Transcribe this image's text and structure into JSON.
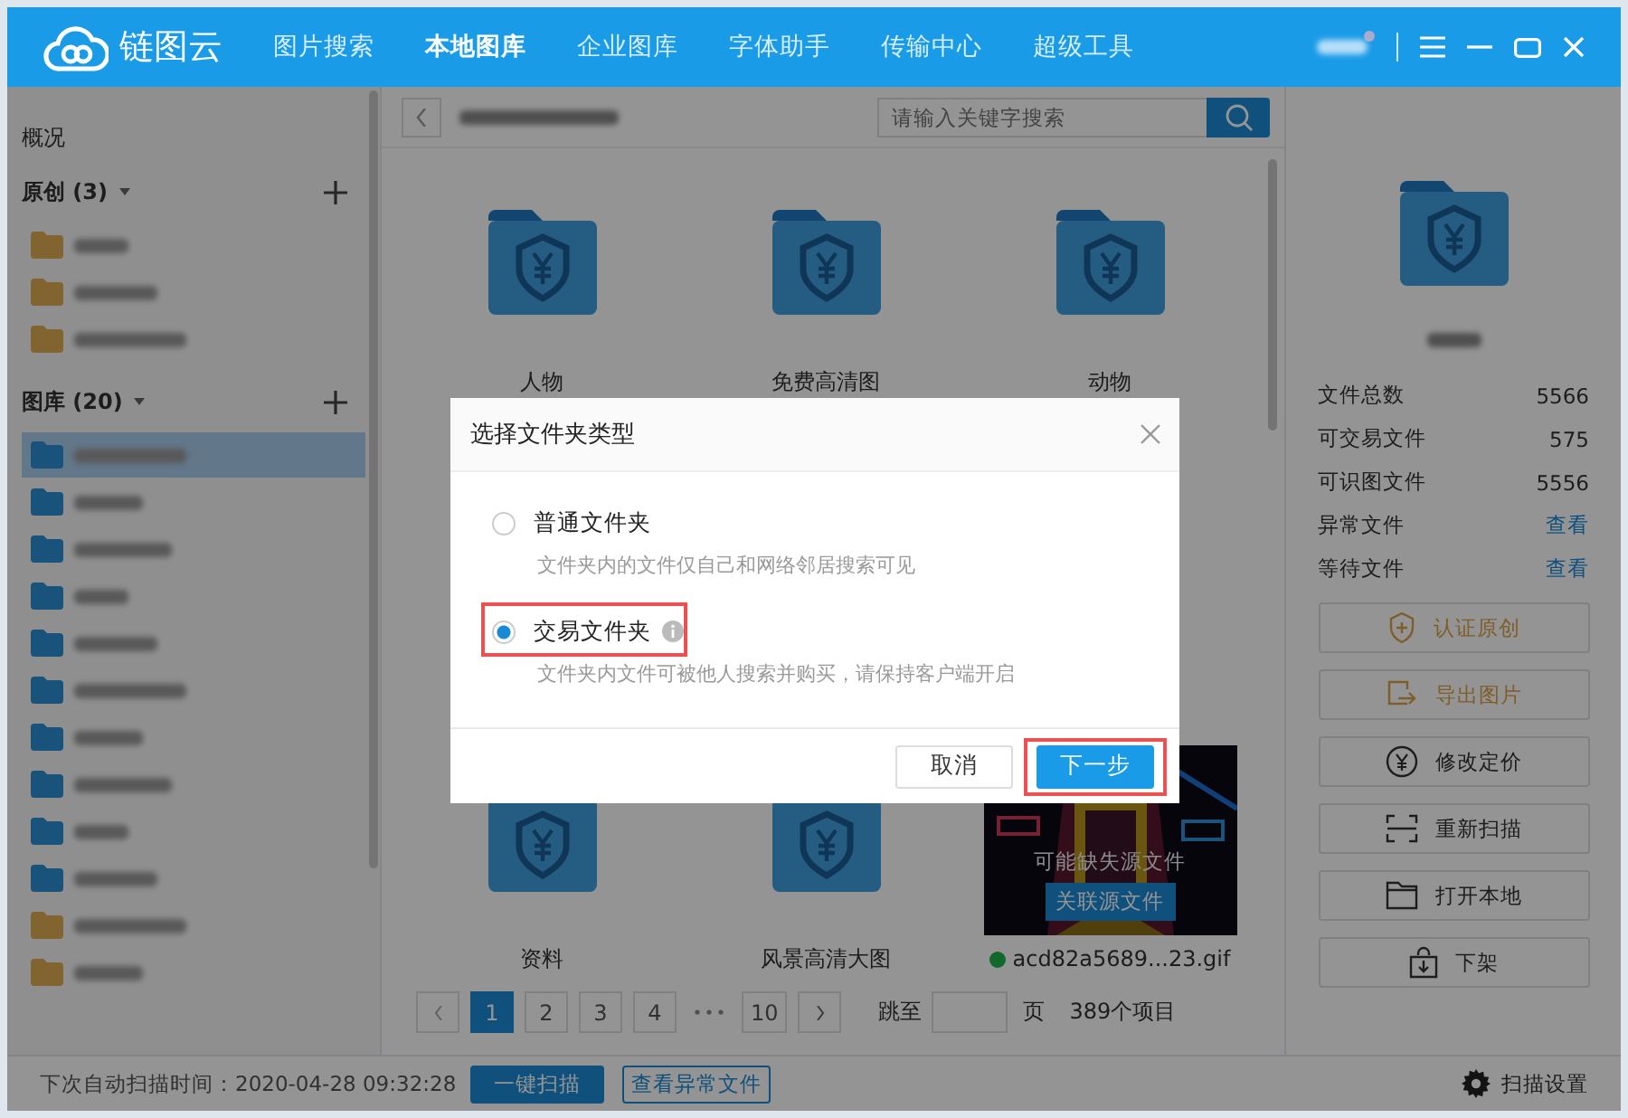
{
  "header": {
    "app_name": "链图云",
    "nav": [
      {
        "label": "图片搜索",
        "selected": false
      },
      {
        "label": "本地图库",
        "selected": true
      },
      {
        "label": "企业图库",
        "selected": false
      },
      {
        "label": "字体助手",
        "selected": false
      },
      {
        "label": "传输中心",
        "selected": false
      },
      {
        "label": "超级工具",
        "selected": false
      }
    ]
  },
  "sidebar": {
    "overview": "概况",
    "sections": [
      {
        "title": "原创",
        "count": "(3)",
        "expanded": true,
        "items": [
          {
            "color": "#826431",
            "selected": false
          },
          {
            "color": "#826431",
            "selected": false
          },
          {
            "color": "#826431",
            "selected": false
          }
        ]
      },
      {
        "title": "图库",
        "count": "(20)",
        "expanded": true,
        "items": [
          {
            "color": "#19537c",
            "selected": true
          },
          {
            "color": "#19537c",
            "selected": false
          },
          {
            "color": "#19537c",
            "selected": false
          },
          {
            "color": "#19537c",
            "selected": false
          },
          {
            "color": "#19537c",
            "selected": false
          },
          {
            "color": "#19537c",
            "selected": false
          },
          {
            "color": "#19537c",
            "selected": false
          },
          {
            "color": "#19537c",
            "selected": false
          },
          {
            "color": "#19537c",
            "selected": false
          },
          {
            "color": "#19537c",
            "selected": false
          },
          {
            "color": "#826431",
            "selected": false
          },
          {
            "color": "#826431",
            "selected": false
          }
        ]
      }
    ]
  },
  "content": {
    "search": {
      "placeholder": "请输入关键字搜索"
    },
    "rows": [
      [
        {
          "kind": "folder",
          "name": "人物"
        },
        {
          "kind": "folder",
          "name": "免费高清图"
        },
        {
          "kind": "folder",
          "name": "动物"
        }
      ],
      [
        {
          "kind": "folder",
          "name": "资料"
        },
        {
          "kind": "folder",
          "name": "风景高清大图"
        },
        {
          "name": "acd82a5689...23.gif",
          "color": "#11682b",
          "warning": "可能缺失源文件",
          "action": "关联源文件"
        }
      ]
    ],
    "pagination": {
      "pages": [
        {
          "label": "1",
          "selected": true
        },
        {
          "label": "2",
          "selected": false
        },
        {
          "label": "3",
          "selected": false
        },
        {
          "label": "4",
          "selected": false
        },
        {
          "label": "10",
          "selected": false
        }
      ],
      "jump_label": "跳至",
      "page_unit": "页",
      "total": "389个项目"
    }
  },
  "right_panel": {
    "stats": [
      {
        "label": "文件总数",
        "value": "5566",
        "kind": "number"
      },
      {
        "label": "可交易文件",
        "value": "575",
        "kind": "number"
      },
      {
        "label": "可识图文件",
        "value": "5556",
        "kind": "number"
      },
      {
        "label": "异常文件",
        "value": "查看",
        "kind": "link"
      },
      {
        "label": "等待文件",
        "value": "查看",
        "kind": "link"
      }
    ],
    "actions": [
      {
        "label": "认证原创",
        "accent": true
      },
      {
        "label": "导出图片",
        "accent": true
      },
      {
        "label": "修改定价",
        "accent": false
      },
      {
        "label": "重新扫描",
        "accent": false
      },
      {
        "label": "打开本地",
        "accent": false
      },
      {
        "label": "下架",
        "accent": false
      }
    ]
  },
  "bottom_bar": {
    "next_scan": "下次自动扫描时间：2020-04-28 09:32:28",
    "scan_button": "一键扫描",
    "abnormal_button": "查看异常文件",
    "settings": "扫描设置"
  },
  "dialog": {
    "title": "选择文件夹类型",
    "options": [
      {
        "label": "普通文件夹",
        "description": "文件夹内的文件仅自己和网络邻居搜索可见",
        "selected": false,
        "info": false,
        "highlighted": false
      },
      {
        "label": "交易文件夹",
        "description": "文件夹内文件可被他人搜索并购买，请保持客户端开启",
        "selected": true,
        "info": true,
        "highlighted": true
      }
    ],
    "buttons": [
      {
        "label": "取消",
        "kind": "secondary",
        "highlighted": false
      },
      {
        "label": "下一步",
        "kind": "primary",
        "highlighted": true
      }
    ]
  }
}
